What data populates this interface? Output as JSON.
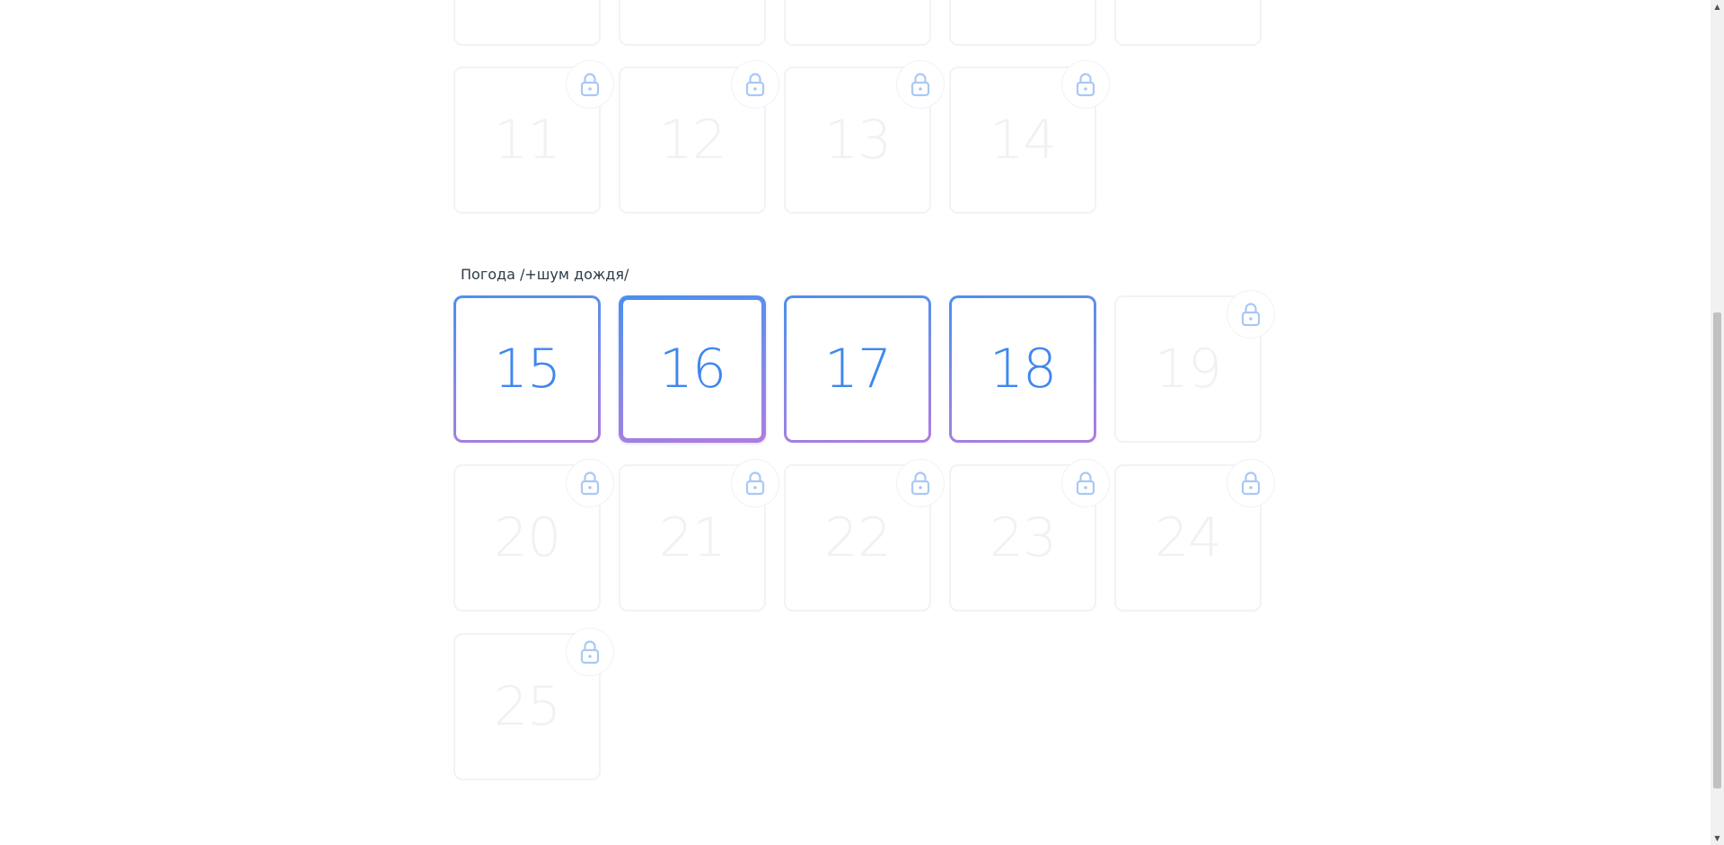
{
  "section": {
    "title": "Погода /+шум дождя/"
  },
  "tiles": {
    "t_top1": "",
    "t_top2": "",
    "t_top3": "",
    "t_top4": "",
    "t_top5": "",
    "t11": "11",
    "t12": "12",
    "t13": "13",
    "t14": "14",
    "t15": "15",
    "t16": "16",
    "t17": "17",
    "t18": "18",
    "t19": "19",
    "t20": "20",
    "t21": "21",
    "t22": "22",
    "t23": "23",
    "t24": "24",
    "t25": "25"
  },
  "states": {
    "open": [
      "15",
      "16",
      "17",
      "18"
    ],
    "selected": "16",
    "locked": [
      "11",
      "12",
      "13",
      "14",
      "19",
      "20",
      "21",
      "22",
      "23",
      "24",
      "25"
    ]
  },
  "colors": {
    "accent_blue": "#3f87ee",
    "gradient_start": "#4a8ff0",
    "gradient_end": "#b07be0",
    "lock_icon": "#a9c8f5",
    "locked_border": "#f1f3f6"
  },
  "icons": {
    "lock": "lock-icon",
    "scroll_up": "scroll-up-arrow-icon",
    "scroll_down": "scroll-down-arrow-icon"
  }
}
